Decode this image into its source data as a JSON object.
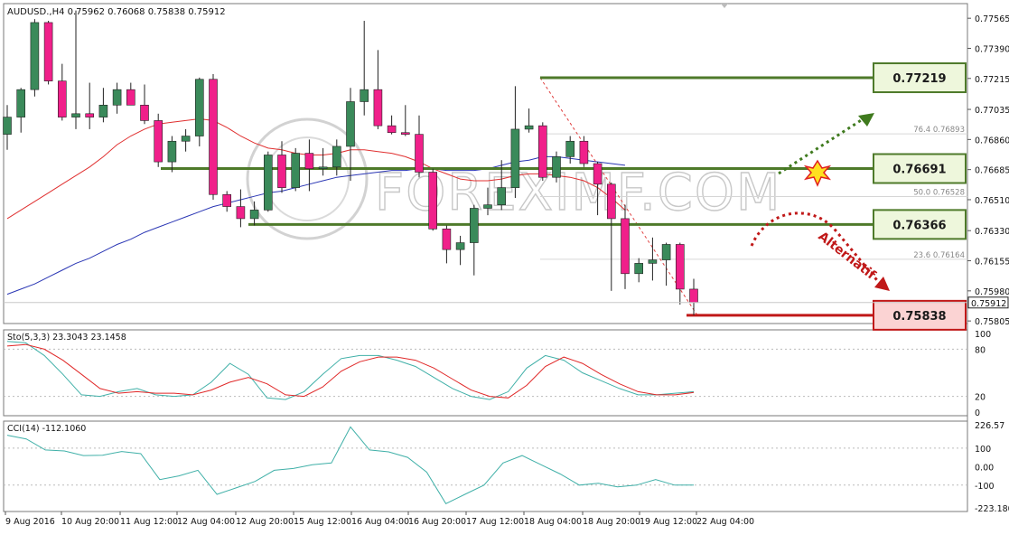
{
  "header": {
    "symbol": "AUDUSD.,H4",
    "ohlc": "0.75962 0.76068 0.75838 0.75912"
  },
  "watermark": "FOREXIMF.COM",
  "chart_data": [
    {
      "type": "candlestick",
      "symbol": "AUDUSD",
      "timeframe": "H4",
      "ylim": [
        0.7579,
        0.7765
      ],
      "y_ticks": [
        "0.77565",
        "0.77390",
        "0.77215",
        "0.77035",
        "0.76860",
        "0.76685",
        "0.76510",
        "0.76330",
        "0.76155",
        "0.75980",
        "0.75805"
      ],
      "x_ticks": [
        "9 Aug 2016",
        "10 Aug 20:00",
        "11 Aug 12:00",
        "12 Aug 04:00",
        "12 Aug 20:00",
        "15 Aug 12:00",
        "16 Aug 04:00",
        "16 Aug 20:00",
        "17 Aug 12:00",
        "18 Aug 04:00",
        "18 Aug 20:00",
        "19 Aug 12:00",
        "22 Aug 04:00"
      ],
      "current_price": "0.75912",
      "colors": {
        "bull": "#3a8a5a",
        "bear": "#f0208a",
        "ma_fast": "#e03030",
        "ma_slow": "#2a36b4",
        "support": "#4e7a2a",
        "resistance_target": "#c01818"
      },
      "candles": [
        {
          "o": 0.7689,
          "h": 0.7706,
          "l": 0.768,
          "c": 0.7699
        },
        {
          "o": 0.7699,
          "h": 0.7716,
          "l": 0.769,
          "c": 0.7715
        },
        {
          "o": 0.7715,
          "h": 0.7756,
          "l": 0.7711,
          "c": 0.7754
        },
        {
          "o": 0.7754,
          "h": 0.7755,
          "l": 0.7718,
          "c": 0.772
        },
        {
          "o": 0.772,
          "h": 0.773,
          "l": 0.7697,
          "c": 0.7699
        },
        {
          "o": 0.7699,
          "h": 0.7761,
          "l": 0.7692,
          "c": 0.7701
        },
        {
          "o": 0.7701,
          "h": 0.7719,
          "l": 0.7692,
          "c": 0.7699
        },
        {
          "o": 0.7699,
          "h": 0.7716,
          "l": 0.7696,
          "c": 0.7706
        },
        {
          "o": 0.7706,
          "h": 0.7719,
          "l": 0.7701,
          "c": 0.7715
        },
        {
          "o": 0.7715,
          "h": 0.7719,
          "l": 0.7708,
          "c": 0.7706
        },
        {
          "o": 0.7706,
          "h": 0.7718,
          "l": 0.7695,
          "c": 0.7697
        },
        {
          "o": 0.7697,
          "h": 0.7701,
          "l": 0.767,
          "c": 0.7673
        },
        {
          "o": 0.7673,
          "h": 0.7688,
          "l": 0.7667,
          "c": 0.7685
        },
        {
          "o": 0.7685,
          "h": 0.7692,
          "l": 0.7679,
          "c": 0.7688
        },
        {
          "o": 0.7688,
          "h": 0.7722,
          "l": 0.7682,
          "c": 0.7721
        },
        {
          "o": 0.7721,
          "h": 0.7724,
          "l": 0.7651,
          "c": 0.7654
        },
        {
          "o": 0.7654,
          "h": 0.7656,
          "l": 0.7644,
          "c": 0.7647
        },
        {
          "o": 0.7647,
          "h": 0.7657,
          "l": 0.7635,
          "c": 0.764
        },
        {
          "o": 0.764,
          "h": 0.765,
          "l": 0.7636,
          "c": 0.7645
        },
        {
          "o": 0.7645,
          "h": 0.7679,
          "l": 0.7644,
          "c": 0.7677
        },
        {
          "o": 0.7677,
          "h": 0.7685,
          "l": 0.7655,
          "c": 0.7658
        },
        {
          "o": 0.7658,
          "h": 0.7681,
          "l": 0.7656,
          "c": 0.7678
        },
        {
          "o": 0.7678,
          "h": 0.7686,
          "l": 0.7656,
          "c": 0.7669
        },
        {
          "o": 0.7669,
          "h": 0.7681,
          "l": 0.7665,
          "c": 0.767
        },
        {
          "o": 0.767,
          "h": 0.7686,
          "l": 0.7665,
          "c": 0.7682
        },
        {
          "o": 0.7682,
          "h": 0.7716,
          "l": 0.7662,
          "c": 0.7708
        },
        {
          "o": 0.7708,
          "h": 0.7755,
          "l": 0.77,
          "c": 0.7715
        },
        {
          "o": 0.7715,
          "h": 0.7738,
          "l": 0.7692,
          "c": 0.7694
        },
        {
          "o": 0.7694,
          "h": 0.77,
          "l": 0.7689,
          "c": 0.769
        },
        {
          "o": 0.769,
          "h": 0.7706,
          "l": 0.7688,
          "c": 0.7689
        },
        {
          "o": 0.7689,
          "h": 0.77,
          "l": 0.7664,
          "c": 0.7667
        },
        {
          "o": 0.7667,
          "h": 0.7669,
          "l": 0.7633,
          "c": 0.7634
        },
        {
          "o": 0.7634,
          "h": 0.7636,
          "l": 0.7614,
          "c": 0.7622
        },
        {
          "o": 0.7622,
          "h": 0.763,
          "l": 0.7613,
          "c": 0.7626
        },
        {
          "o": 0.7626,
          "h": 0.7648,
          "l": 0.7607,
          "c": 0.7646
        },
        {
          "o": 0.7646,
          "h": 0.7658,
          "l": 0.7642,
          "c": 0.7648
        },
        {
          "o": 0.7648,
          "h": 0.7674,
          "l": 0.7645,
          "c": 0.7658
        },
        {
          "o": 0.7658,
          "h": 0.7717,
          "l": 0.7652,
          "c": 0.7692
        },
        {
          "o": 0.7692,
          "h": 0.7704,
          "l": 0.769,
          "c": 0.7694
        },
        {
          "o": 0.7694,
          "h": 0.7696,
          "l": 0.7662,
          "c": 0.7664
        },
        {
          "o": 0.7664,
          "h": 0.7679,
          "l": 0.7661,
          "c": 0.7676
        },
        {
          "o": 0.7676,
          "h": 0.7688,
          "l": 0.7672,
          "c": 0.7685
        },
        {
          "o": 0.7685,
          "h": 0.7688,
          "l": 0.767,
          "c": 0.7672
        },
        {
          "o": 0.7672,
          "h": 0.7673,
          "l": 0.7642,
          "c": 0.766
        },
        {
          "o": 0.766,
          "h": 0.7661,
          "l": 0.7598,
          "c": 0.764
        },
        {
          "o": 0.764,
          "h": 0.7648,
          "l": 0.7599,
          "c": 0.7608
        },
        {
          "o": 0.7608,
          "h": 0.7617,
          "l": 0.7603,
          "c": 0.7614
        },
        {
          "o": 0.7614,
          "h": 0.7629,
          "l": 0.7604,
          "c": 0.7616
        },
        {
          "o": 0.7616,
          "h": 0.7626,
          "l": 0.7601,
          "c": 0.7625
        },
        {
          "o": 0.7625,
          "h": 0.7626,
          "l": 0.759,
          "c": 0.7599
        },
        {
          "o": 0.7599,
          "h": 0.7605,
          "l": 0.75838,
          "c": 0.75912
        }
      ],
      "ma_fast": [
        0.764,
        0.7645,
        0.765,
        0.7655,
        0.766,
        0.7665,
        0.767,
        0.7676,
        0.7683,
        0.7688,
        0.7692,
        0.7695,
        0.7696,
        0.7697,
        0.7698,
        0.7697,
        0.7693,
        0.7688,
        0.7684,
        0.7681,
        0.768,
        0.7678,
        0.7677,
        0.7677,
        0.7678,
        0.768,
        0.768,
        0.7679,
        0.7678,
        0.7676,
        0.7673,
        0.7669,
        0.7666,
        0.7663,
        0.7662,
        0.7662,
        0.7663,
        0.7665,
        0.7666,
        0.7666,
        0.7665,
        0.7664,
        0.7662,
        0.7658,
        0.7652,
        0.7645
      ],
      "ma_slow": [
        0.7596,
        0.7599,
        0.7602,
        0.7606,
        0.761,
        0.7614,
        0.7617,
        0.7621,
        0.7625,
        0.7628,
        0.7632,
        0.7635,
        0.7638,
        0.7641,
        0.7644,
        0.7647,
        0.7649,
        0.7651,
        0.7653,
        0.7655,
        0.7656,
        0.7658,
        0.766,
        0.7662,
        0.7664,
        0.7665,
        0.7666,
        0.7667,
        0.7668,
        0.7668,
        0.7669,
        0.7669,
        0.7668,
        0.7668,
        0.7668,
        0.7669,
        0.7671,
        0.7673,
        0.7674,
        0.7676,
        0.7676,
        0.7675,
        0.7674,
        0.7673,
        0.7672,
        0.7671
      ],
      "levels": [
        {
          "label": "0.77219",
          "price": 0.77219,
          "kind": "resistance"
        },
        {
          "label": "0.76691",
          "price": 0.76691,
          "kind": "support"
        },
        {
          "label": "0.76366",
          "price": 0.76366,
          "kind": "support"
        },
        {
          "label": "0.75838",
          "price": 0.75838,
          "kind": "target"
        }
      ],
      "fibonacci": [
        {
          "label": "76.4",
          "price_label": "0.76893",
          "price": 0.76893
        },
        {
          "label": "50.0",
          "price_label": "0.76528",
          "price": 0.76528
        },
        {
          "label": "23.6",
          "price_label": "0.76164",
          "price": 0.76164
        }
      ],
      "annotation": "Alternatif"
    },
    {
      "type": "line",
      "name": "Sto(5,3,3) 23.3043 23.1458",
      "ylim": [
        0,
        100
      ],
      "y_ticks": [
        "100",
        "80",
        "20",
        "0"
      ],
      "series": [
        {
          "color": "#40b0a8",
          "values": [
            90,
            88,
            72,
            48,
            22,
            20,
            26,
            30,
            22,
            20,
            22,
            38,
            62,
            48,
            18,
            16,
            26,
            48,
            68,
            72,
            72,
            66,
            58,
            44,
            30,
            20,
            16,
            26,
            56,
            72,
            66,
            50,
            40,
            30,
            22,
            22,
            24,
            26
          ]
        },
        {
          "color": "#e02828",
          "values": [
            84,
            86,
            80,
            66,
            48,
            30,
            24,
            26,
            24,
            24,
            22,
            28,
            38,
            44,
            36,
            22,
            20,
            32,
            52,
            64,
            70,
            70,
            66,
            56,
            42,
            28,
            20,
            18,
            34,
            58,
            70,
            62,
            48,
            36,
            26,
            22,
            22,
            25
          ]
        }
      ]
    },
    {
      "type": "line",
      "name": "CCI(14) -112.1060",
      "ylim": [
        -223.18,
        226.57
      ],
      "y_ticks": [
        "226.57",
        "100",
        "0.00",
        "-100",
        "-223.1805"
      ],
      "series": [
        {
          "color": "#40b0a8",
          "values": [
            170,
            150,
            90,
            85,
            60,
            62,
            82,
            70,
            -70,
            -50,
            -20,
            -150,
            -115,
            -80,
            -20,
            -10,
            10,
            20,
            215,
            90,
            80,
            50,
            -30,
            -200,
            -150,
            -100,
            20,
            60,
            10,
            -40,
            -100,
            -90,
            -110,
            -100,
            -70,
            -100,
            -100
          ]
        }
      ]
    }
  ]
}
